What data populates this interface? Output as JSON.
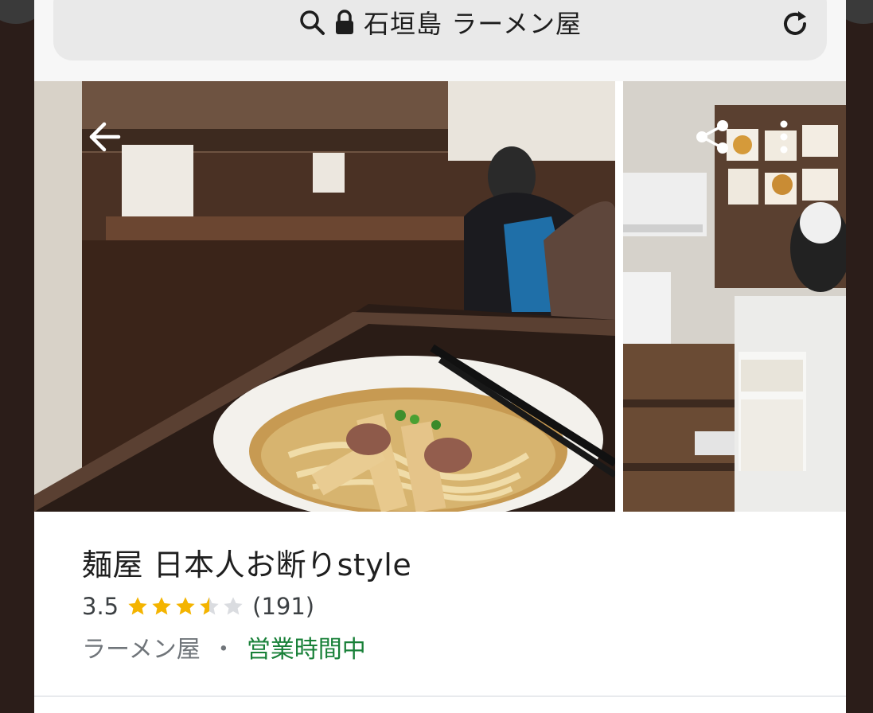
{
  "address_bar": {
    "query": "石垣島 ラーメン屋",
    "icons": [
      "search-icon",
      "lock-icon",
      "reload-icon"
    ]
  },
  "photos": {
    "main_alt": "ramen bowl with chopsticks on counter",
    "side_alt": "shop interior with ticket machine",
    "controls": [
      "back-arrow-icon",
      "share-icon",
      "more-vert-icon"
    ]
  },
  "place": {
    "name": "麺屋 日本人お断りstyle",
    "rating": "3.5",
    "rating_value": 3.5,
    "review_count": "(191)",
    "category": "ラーメン屋",
    "separator": "・",
    "status": "営業時間中"
  },
  "colors": {
    "star": "#F4B400",
    "star_empty": "#DADCE0",
    "open_status": "#188038"
  }
}
